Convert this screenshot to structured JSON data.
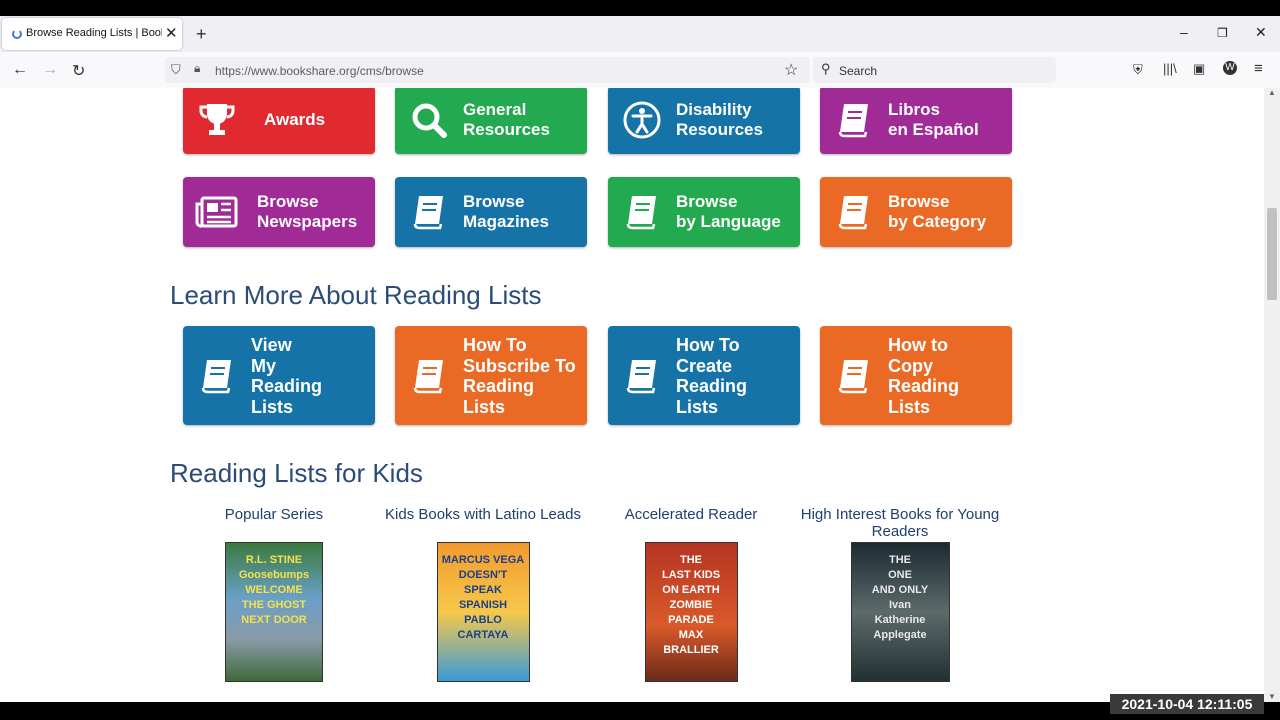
{
  "browser": {
    "tab_title": "Browse Reading Lists | Bookshare",
    "url": "https://www.bookshare.org/cms/browse",
    "search_placeholder": "Search"
  },
  "tiles_row1": [
    {
      "label": "Awards",
      "color": "#e02a2f",
      "icon": "trophy-icon"
    },
    {
      "label": "General\nResources",
      "color": "#23a94f",
      "icon": "search-icon"
    },
    {
      "label": "Disability\nResources",
      "color": "#1573a8",
      "icon": "accessibility-icon"
    },
    {
      "label": "Libros\nen Español",
      "color": "#a02b97",
      "icon": "book-icon"
    }
  ],
  "tiles_row2": [
    {
      "label": "Browse\nNewspapers",
      "color": "#a02b97",
      "icon": "newspaper-icon"
    },
    {
      "label": "Browse\nMagazines",
      "color": "#1573a8",
      "icon": "book-icon"
    },
    {
      "label": "Browse\nby Language",
      "color": "#23a94f",
      "icon": "book-icon"
    },
    {
      "label": "Browse\nby Category",
      "color": "#ea6a25",
      "icon": "book-icon"
    }
  ],
  "section_reading_lists": "Learn More About Reading Lists",
  "tiles_row3": [
    {
      "label": "View\nMy\nReading\nLists",
      "color": "#1573a8",
      "icon": "book-icon"
    },
    {
      "label": "How To\nSubscribe To\nReading\nLists",
      "color": "#ea6a25",
      "icon": "book-icon"
    },
    {
      "label": "How To\nCreate\nReading\nLists",
      "color": "#1573a8",
      "icon": "book-icon"
    },
    {
      "label": "How to\nCopy\nReading\nLists",
      "color": "#ea6a25",
      "icon": "book-icon"
    }
  ],
  "section_kids": "Reading Lists for Kids",
  "kids_lists": [
    {
      "title": "Popular Series",
      "cover_text": "R.L. STINE\nGoosebumps\nWELCOME\nTHE GHOST NEXT DOOR"
    },
    {
      "title": "Kids Books with Latino Leads",
      "cover_text": "MARCUS VEGA\nDOESN'T\nSPEAK\nSPANISH\nPABLO CARTAYA"
    },
    {
      "title": "Accelerated Reader",
      "cover_text": "THE\nLAST KIDS\nON EARTH\nZOMBIE PARADE\nMAX BRALLIER"
    },
    {
      "title": "High Interest Books for Young Readers",
      "cover_text": "THE\nONE\nAND ONLY\nIvan\nKatherine Applegate"
    }
  ],
  "timestamp": "2021-10-04  12:11:05"
}
